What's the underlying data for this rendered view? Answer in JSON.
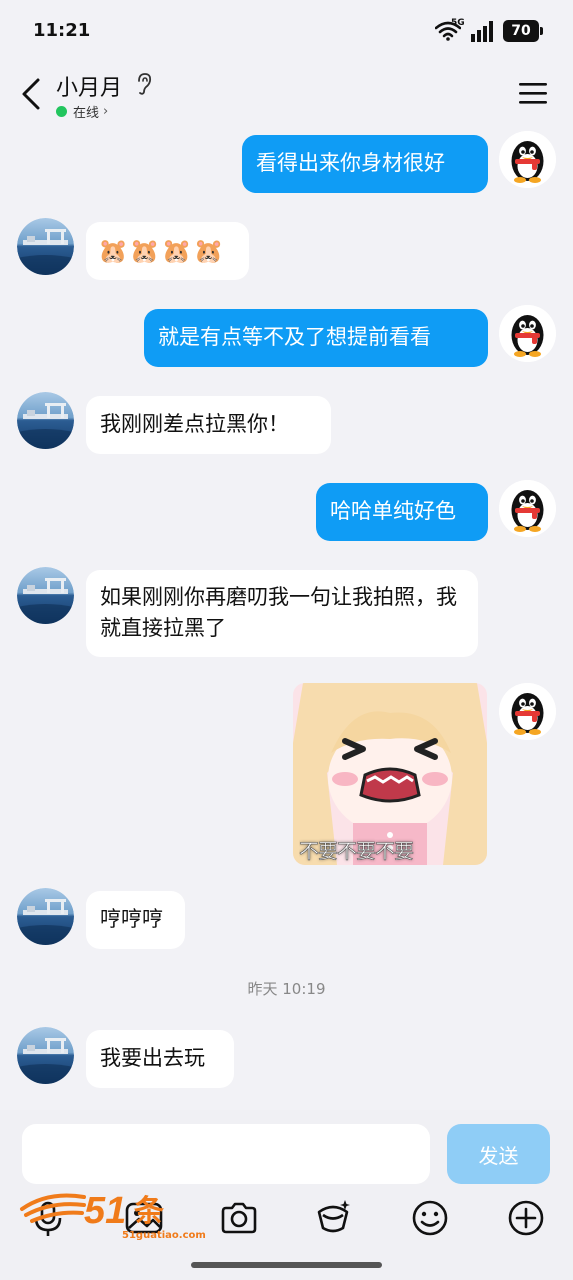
{
  "status": {
    "time": "11:21",
    "network": "5G",
    "battery": "70"
  },
  "header": {
    "title": "小月月",
    "presence": "在线"
  },
  "messages": [
    {
      "side": "me",
      "text": "看得出来你身材很好"
    },
    {
      "side": "peer",
      "emoji": "🐹🐹🐹🐹"
    },
    {
      "side": "me",
      "text": "就是有点等不及了想提前看看"
    },
    {
      "side": "peer",
      "text": "我刚刚差点拉黑你！"
    },
    {
      "side": "me",
      "text": "哈哈单纯好色"
    },
    {
      "side": "peer",
      "text": "如果刚刚你再磨叨我一句让我拍照，我就直接拉黑了"
    },
    {
      "side": "me",
      "sticker_caption": "不要不要不要"
    },
    {
      "side": "peer",
      "text": "哼哼哼"
    },
    {
      "side": "peer",
      "text": "我要出去玩"
    }
  ],
  "time_divider": "昨天 10:19",
  "input": {
    "placeholder": "",
    "send_label": "发送"
  },
  "toolbar": [
    "voice-icon",
    "image-icon",
    "camera-icon",
    "red-packet-icon",
    "emoji-icon",
    "plus-icon"
  ],
  "watermark": {
    "brand": "51吃瓜",
    "url": "51guatiao.com"
  },
  "colors": {
    "my_bubble": "#0f9cf5",
    "peer_bubble": "#ffffff",
    "background": "#f2f2f6",
    "online_dot": "#22c55e",
    "send_disabled": "#8fcdf6"
  }
}
